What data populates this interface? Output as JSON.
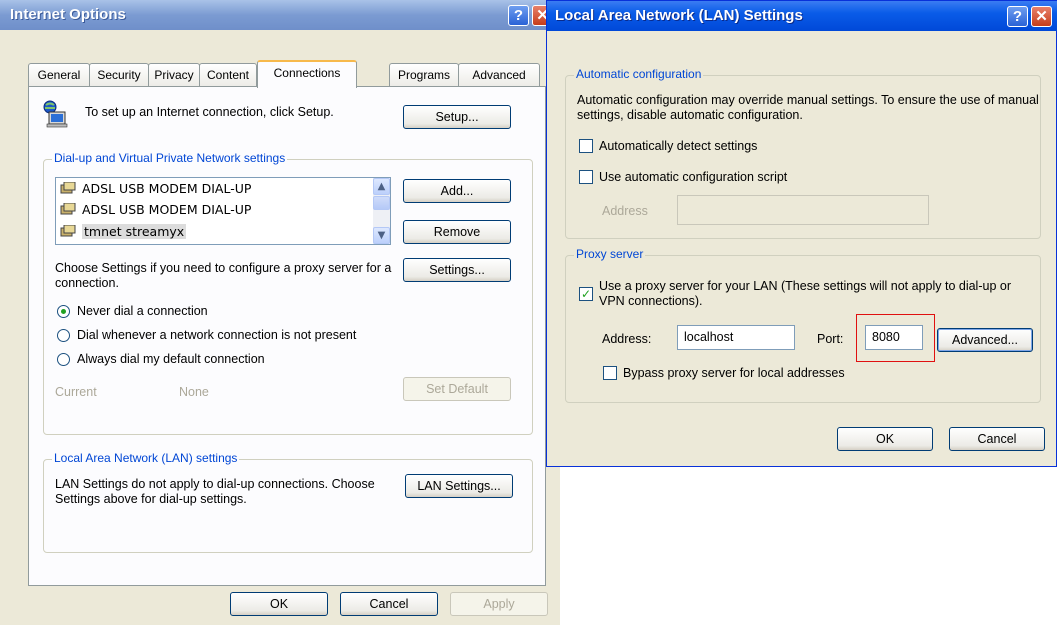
{
  "internet_options": {
    "title": "Internet Options",
    "tabs": [
      "General",
      "Security",
      "Privacy",
      "Content",
      "Connections",
      "Programs",
      "Advanced"
    ],
    "active_tab": "Connections",
    "setup_text": "To set up an Internet connection, click Setup.",
    "setup_button": "Setup...",
    "dialup_group": {
      "label": "Dial-up and Virtual Private Network settings",
      "items": [
        "ADSL USB MODEM DIAL-UP",
        "ADSL USB MODEM DIAL-UP",
        "tmnet streamyx"
      ],
      "add_button": "Add...",
      "remove_button": "Remove",
      "choose_text": "Choose Settings if you need to configure a proxy server for a connection.",
      "settings_button": "Settings...",
      "radios": [
        "Never dial a connection",
        "Dial whenever a network connection is not present",
        "Always dial my default connection"
      ],
      "selected_radio": 0,
      "current_label": "Current",
      "current_value": "None",
      "set_default_button": "Set Default"
    },
    "lan_group": {
      "label": "Local Area Network (LAN) settings",
      "text": "LAN Settings do not apply to dial-up connections. Choose Settings above for dial-up settings.",
      "lan_button": "LAN Settings..."
    },
    "ok_button": "OK",
    "cancel_button": "Cancel",
    "apply_button": "Apply"
  },
  "lan_settings": {
    "title": "Local Area Network (LAN) Settings",
    "auto_group": {
      "label": "Automatic configuration",
      "text": "Automatic configuration may override manual settings. To ensure the use of manual settings, disable automatic configuration.",
      "auto_detect_label": "Automatically detect settings",
      "auto_script_label": "Use automatic configuration script",
      "address_label": "Address",
      "address_value": ""
    },
    "proxy_group": {
      "label": "Proxy server",
      "use_proxy_label": "Use a proxy server for your LAN (These settings will not apply to dial-up or VPN connections).",
      "use_proxy_checked": true,
      "address_label": "Address:",
      "address_value": "localhost",
      "port_label": "Port:",
      "port_value": "8080",
      "advanced_button": "Advanced...",
      "bypass_label": "Bypass proxy server for local addresses"
    },
    "ok_button": "OK",
    "cancel_button": "Cancel"
  },
  "icons": {
    "help": "help-icon",
    "close": "close-icon"
  },
  "colors": {
    "group_label": "#0046d5",
    "title_active": "#0a5ce8",
    "title_inactive": "#7b9bd2",
    "highlight": "#e01010"
  }
}
